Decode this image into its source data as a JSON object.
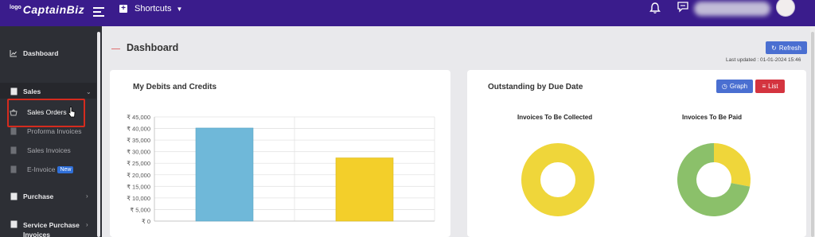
{
  "topbar": {
    "logo_small": "logo",
    "logo_main": "CaptainBiz",
    "shortcuts_label": "Shortcuts",
    "user_name": ""
  },
  "sidebar": {
    "dashboard": "Dashboard",
    "sales": "Sales",
    "sales_orders": "Sales Orders",
    "proforma_invoices": "Proforma Invoices",
    "sales_invoices": "Sales Invoices",
    "e_invoice": "E-Invoice",
    "new_badge": "New",
    "purchase": "Purchase",
    "service_purchase_invoices_line1": "Service Purchase",
    "service_purchase_invoices_line2": "Invoices"
  },
  "header": {
    "title": "Dashboard",
    "refresh_label": "Refresh",
    "last_updated": "Last updated : 01-01-2024 15:46"
  },
  "debits_card": {
    "title": "My Debits and Credits"
  },
  "outstanding_card": {
    "title": "Outstanding by Due Date",
    "graph_label": "Graph",
    "list_label": "List",
    "collected_title": "Invoices To Be Collected",
    "paid_title": "Invoices To Be Paid"
  },
  "colors": {
    "topbar": "#3a1c8c",
    "sidebar": "#2d2f35",
    "accent_blue": "#4a6fd1",
    "accent_red": "#d4343f",
    "bar_debit": "#6fb8d9",
    "bar_credit": "#f3cf2a",
    "donut_yellow": "#efd63a",
    "donut_green": "#8bc06a"
  },
  "chart_data": [
    {
      "type": "bar",
      "categories": [
        "",
        ""
      ],
      "values": [
        40200,
        27300
      ],
      "ylim": [
        0,
        45000
      ],
      "y_ticks": [
        "₹ 0",
        "₹ 5,000",
        "₹ 10,000",
        "₹ 15,000",
        "₹ 20,000",
        "₹ 25,000",
        "₹ 30,000",
        "₹ 35,000",
        "₹ 40,000",
        "₹ 45,000"
      ],
      "y_tick_values": [
        0,
        5000,
        10000,
        15000,
        20000,
        25000,
        30000,
        35000,
        40000,
        45000
      ],
      "grid": true,
      "colors": [
        "#6fb8d9",
        "#f3cf2a"
      ]
    },
    {
      "type": "pie",
      "donut": true,
      "slices": [
        {
          "label": "",
          "value": 100,
          "color": "#efd63a"
        }
      ]
    },
    {
      "type": "pie",
      "donut": true,
      "slices": [
        {
          "label": "",
          "value": 72,
          "color": "#8bc06a"
        },
        {
          "label": "",
          "value": 28,
          "color": "#efd63a"
        }
      ]
    }
  ]
}
